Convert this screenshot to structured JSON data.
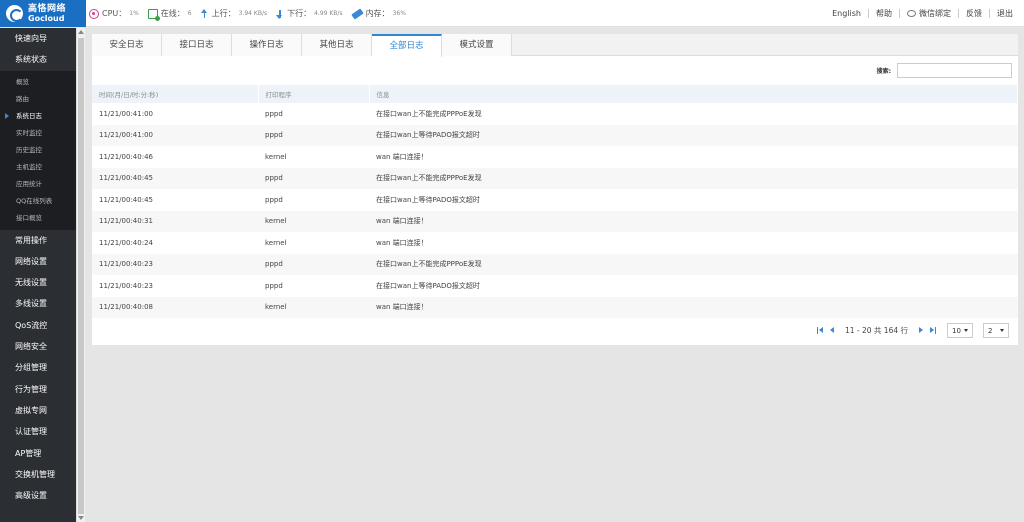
{
  "brand": {
    "name_cn": "高恪网络",
    "name_en": "Gocloud"
  },
  "stats": {
    "cpu_label": "CPU：",
    "cpu_value": "1%",
    "online_label": "在线：",
    "online_value": "6",
    "up_label": "上行：",
    "up_value": "3.94 KB/s",
    "down_label": "下行：",
    "down_value": "4.99 KB/s",
    "mem_label": "内存：",
    "mem_value": "36%"
  },
  "toplinks": {
    "english": "English",
    "help": "帮助",
    "wechat": "微信绑定",
    "feedback": "反馈",
    "logout": "退出"
  },
  "sidebar": {
    "top_items": [
      "快速向导",
      "系统状态"
    ],
    "sub_items": [
      "概览",
      "路由",
      "系统日志",
      "实时监控",
      "历史监控",
      "主机监控",
      "应用统计",
      "QQ在线列表",
      "接口概览"
    ],
    "active_sub": 2,
    "bottom_items": [
      "常用操作",
      "网络设置",
      "无线设置",
      "多线设置",
      "QoS流控",
      "网络安全",
      "分组管理",
      "行为管理",
      "虚拟专网",
      "认证管理",
      "AP管理",
      "交换机管理",
      "高级设置"
    ]
  },
  "tabs": [
    "安全日志",
    "接口日志",
    "操作日志",
    "其他日志",
    "全部日志",
    "模式设置"
  ],
  "active_tab": 4,
  "search": {
    "label": "搜索:",
    "placeholder": ""
  },
  "table": {
    "headers": [
      "时间(月/日/时:分:秒)",
      "打印程序",
      "信息"
    ],
    "rows": [
      [
        "11/21/00:41:00",
        "pppd",
        "在接口wan上不能完成PPPoE发现"
      ],
      [
        "11/21/00:41:00",
        "pppd",
        "在接口wan上等待PADO报文超时"
      ],
      [
        "11/21/00:40:46",
        "kernel",
        "wan 端口连接！"
      ],
      [
        "11/21/00:40:45",
        "pppd",
        "在接口wan上不能完成PPPoE发现"
      ],
      [
        "11/21/00:40:45",
        "pppd",
        "在接口wan上等待PADO报文超时"
      ],
      [
        "11/21/00:40:31",
        "kernel",
        "wan 端口连接！"
      ],
      [
        "11/21/00:40:24",
        "kernel",
        "wan 端口连接！"
      ],
      [
        "11/21/00:40:23",
        "pppd",
        "在接口wan上不能完成PPPoE发现"
      ],
      [
        "11/21/00:40:23",
        "pppd",
        "在接口wan上等待PADO报文超时"
      ],
      [
        "11/21/00:40:08",
        "kernel",
        "wan 端口连接！"
      ]
    ]
  },
  "pager": {
    "info": "11 - 20 共 164 行",
    "page_size": "10",
    "page": "2"
  },
  "colors": {
    "accent": "#2f86d3",
    "sidebar_bg": "#2b2e33",
    "logo_bg": "#1b6fc3"
  }
}
